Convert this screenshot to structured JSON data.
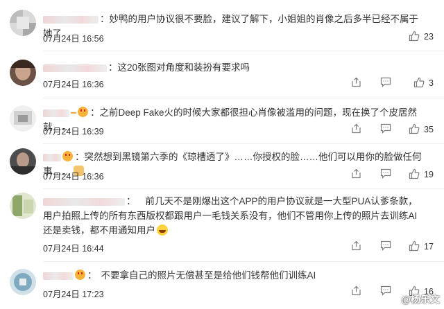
{
  "comments": [
    {
      "text": "妙鸭的用户协议很不要脸，建议了解下，小姐姐的肖像之后多半已经不属于她了",
      "time": "07月24日 16:56",
      "likes": "23"
    },
    {
      "text": "这20张图对角度和装扮有要求吗",
      "time": "07月24日 16:36",
      "likes": "3"
    },
    {
      "text": "之前Deep Fake火的时候大家都很担心肖像被滥用的问题，现在换了个皮居然就……",
      "time": "07月24日 16:39",
      "likes": "35"
    },
    {
      "text": "突然想到黑镜第六季的《琼槽透了》……你授权的脸……他们可以用你的脸做任何事……",
      "time": "07月24日 16:36",
      "likes": "19"
    },
    {
      "text": "前几天不是刚爆出这个APP的用户协议就是一大型PUA认爹条款，用户拍照上传的所有东西版权都跟用户一毛钱关系没有，他们不管用你上传的照片去训练AI还是卖钱，都不用通知用户",
      "time": "07月24日 16:44",
      "likes": "17"
    },
    {
      "text": "不要拿自己的照片无偿甚至是给他们钱帮他们训练AI",
      "time": "07月24日 17:23",
      "likes": "16"
    }
  ],
  "colon": "：",
  "watermark": "@杨乐文",
  "colors": {
    "text": "#333333",
    "icon": "#7a7a7a",
    "divider": "#eeeeee"
  },
  "icons": [
    "share-icon",
    "comment-icon",
    "like-icon"
  ]
}
